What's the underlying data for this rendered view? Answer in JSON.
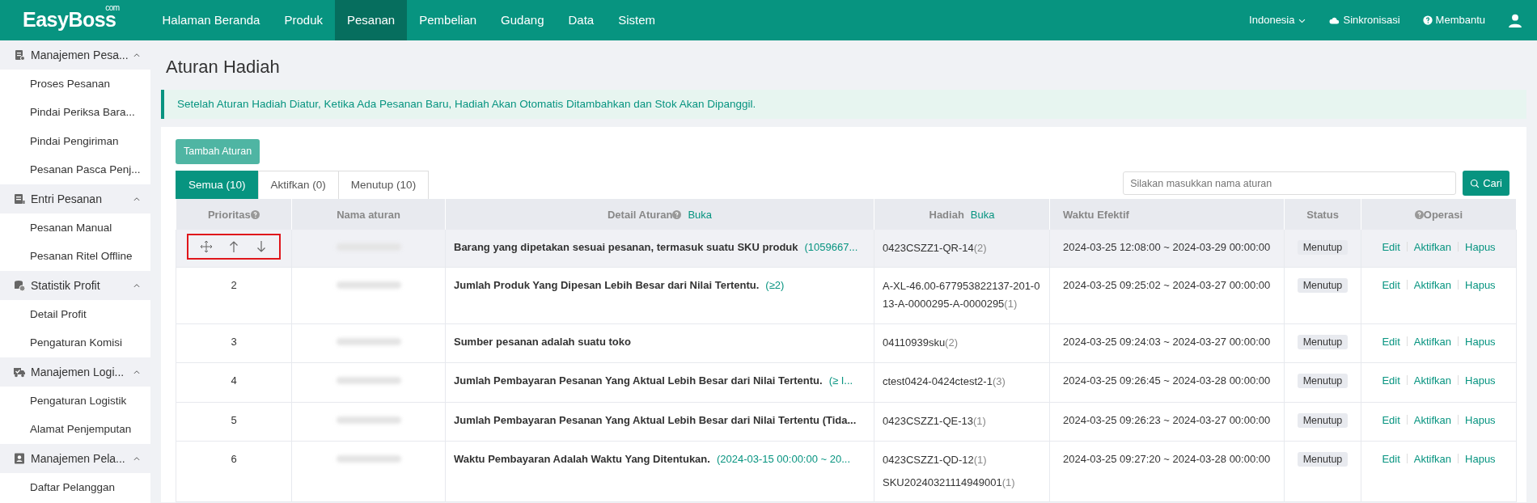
{
  "navbar": {
    "logo": "EasyBoss",
    "logo_suffix": "com",
    "menu": [
      {
        "label": "Halaman Beranda",
        "selected": false
      },
      {
        "label": "Produk",
        "selected": false
      },
      {
        "label": "Pesanan",
        "selected": true
      },
      {
        "label": "Pembelian",
        "selected": false
      },
      {
        "label": "Gudang",
        "selected": false
      },
      {
        "label": "Data",
        "selected": false
      },
      {
        "label": "Sistem",
        "selected": false
      }
    ],
    "language": "Indonesia",
    "sync": "Sinkronisasi",
    "help": "Membantu"
  },
  "sidebar": {
    "groups": [
      {
        "label": "Manajemen Pesa...",
        "expanded": true,
        "children": [
          {
            "label": "Proses Pesanan"
          },
          {
            "label": "Pindai Periksa Bara..."
          },
          {
            "label": "Pindai Pengiriman"
          },
          {
            "label": "Pesanan Pasca Penj..."
          }
        ]
      },
      {
        "label": "Entri Pesanan",
        "expanded": true,
        "children": [
          {
            "label": "Pesanan Manual"
          },
          {
            "label": "Pesanan Ritel Offline"
          }
        ]
      },
      {
        "label": "Statistik Profit",
        "expanded": true,
        "children": [
          {
            "label": "Detail Profit"
          },
          {
            "label": "Pengaturan Komisi"
          }
        ]
      },
      {
        "label": "Manajemen Logi...",
        "expanded": true,
        "children": [
          {
            "label": "Pengaturan Logistik"
          },
          {
            "label": "Alamat Penjemputan"
          }
        ]
      },
      {
        "label": "Manajemen Pela...",
        "expanded": true,
        "children": [
          {
            "label": "Daftar Pelanggan"
          }
        ]
      }
    ]
  },
  "page": {
    "title": "Aturan Hadiah",
    "notice": "Setelah Aturan Hadiah Diatur, Ketika Ada Pesanan Baru, Hadiah Akan Otomatis Ditambahkan dan Stok Akan Dipanggil.",
    "add_button": "Tambah Aturan",
    "tabs": [
      {
        "label": "Semua (10)",
        "selected": true
      },
      {
        "label": "Aktifkan (0)",
        "selected": false
      },
      {
        "label": "Menutup (10)",
        "selected": false
      }
    ],
    "search": {
      "placeholder": "Silakan masukkan nama aturan",
      "button": "Cari"
    }
  },
  "table": {
    "columns": [
      {
        "label": "Prioritas",
        "help": true
      },
      {
        "label": "Nama aturan",
        "help": false
      },
      {
        "label": "Detail Aturan",
        "help": true,
        "toggle": "Buka"
      },
      {
        "label": "Hadiah",
        "help": false,
        "toggle": "Buka"
      },
      {
        "label": "Waktu Efektif",
        "help": false
      },
      {
        "label": "Status",
        "help": false
      },
      {
        "label": "Operasi",
        "help": true
      }
    ],
    "rows": [
      {
        "priority": null,
        "reorder_controls": true,
        "annotated": true,
        "hovered": true,
        "detail": "Barang yang dipetakan sesuai pesanan, termasuk suatu SKU produk",
        "detail_value": "(1059667...",
        "gifts": [
          {
            "name": "0423CSZZ1-QR-14",
            "count": "(2)"
          }
        ],
        "time": "2024-03-25 12:08:00 ~ 2024-03-29 00:00:00",
        "status": "Menutup",
        "actions": [
          "Edit",
          "Aktifkan",
          "Hapus"
        ]
      },
      {
        "priority": "2",
        "reorder_controls": false,
        "annotated": false,
        "hovered": false,
        "detail": "Jumlah Produk Yang Dipesan Lebih Besar dari Nilai Tertentu.",
        "detail_value": "(≥2)",
        "gifts": [
          {
            "name": "A-XL-46.00-677953822137-201-013-A-0000295-A-0000295",
            "count": "(1)"
          }
        ],
        "time": "2024-03-25 09:25:02 ~ 2024-03-27 00:00:00",
        "status": "Menutup",
        "actions": [
          "Edit",
          "Aktifkan",
          "Hapus"
        ]
      },
      {
        "priority": "3",
        "reorder_controls": false,
        "annotated": false,
        "hovered": false,
        "detail": "Sumber pesanan adalah suatu toko",
        "detail_value": null,
        "gifts": [
          {
            "name": "04110939sku",
            "count": "(2)"
          }
        ],
        "time": "2024-03-25 09:24:03 ~ 2024-03-27 00:00:00",
        "status": "Menutup",
        "actions": [
          "Edit",
          "Aktifkan",
          "Hapus"
        ]
      },
      {
        "priority": "4",
        "reorder_controls": false,
        "annotated": false,
        "hovered": false,
        "detail": "Jumlah Pembayaran Pesanan Yang Aktual Lebih Besar dari Nilai Tertentu.",
        "detail_value": "(≥ I...",
        "gifts": [
          {
            "name": "ctest0424-0424ctest2-1",
            "count": "(3)"
          }
        ],
        "time": "2024-03-25 09:26:45 ~ 2024-03-28 00:00:00",
        "status": "Menutup",
        "actions": [
          "Edit",
          "Aktifkan",
          "Hapus"
        ]
      },
      {
        "priority": "5",
        "reorder_controls": false,
        "annotated": false,
        "hovered": false,
        "detail": "Jumlah Pembayaran Pesanan Yang Aktual Lebih Besar dari Nilai Tertentu (Tida...",
        "detail_value": null,
        "gifts": [
          {
            "name": "0423CSZZ1-QE-13",
            "count": "(1)"
          }
        ],
        "time": "2024-03-25 09:26:23 ~ 2024-03-27 00:00:00",
        "status": "Menutup",
        "actions": [
          "Edit",
          "Aktifkan",
          "Hapus"
        ]
      },
      {
        "priority": "6",
        "reorder_controls": false,
        "annotated": false,
        "hovered": false,
        "detail": "Waktu Pembayaran Adalah Waktu Yang Ditentukan.",
        "detail_value": "(2024-03-15 00:00:00 ~ 20...",
        "gifts": [
          {
            "name": "0423CSZZ1-QD-12",
            "count": "(1)"
          },
          {
            "name": "SKU20240321114949001",
            "count": "(1)"
          }
        ],
        "time": "2024-03-25 09:27:20 ~ 2024-03-28 00:00:00",
        "status": "Menutup",
        "actions": [
          "Edit",
          "Aktifkan",
          "Hapus"
        ]
      }
    ]
  }
}
